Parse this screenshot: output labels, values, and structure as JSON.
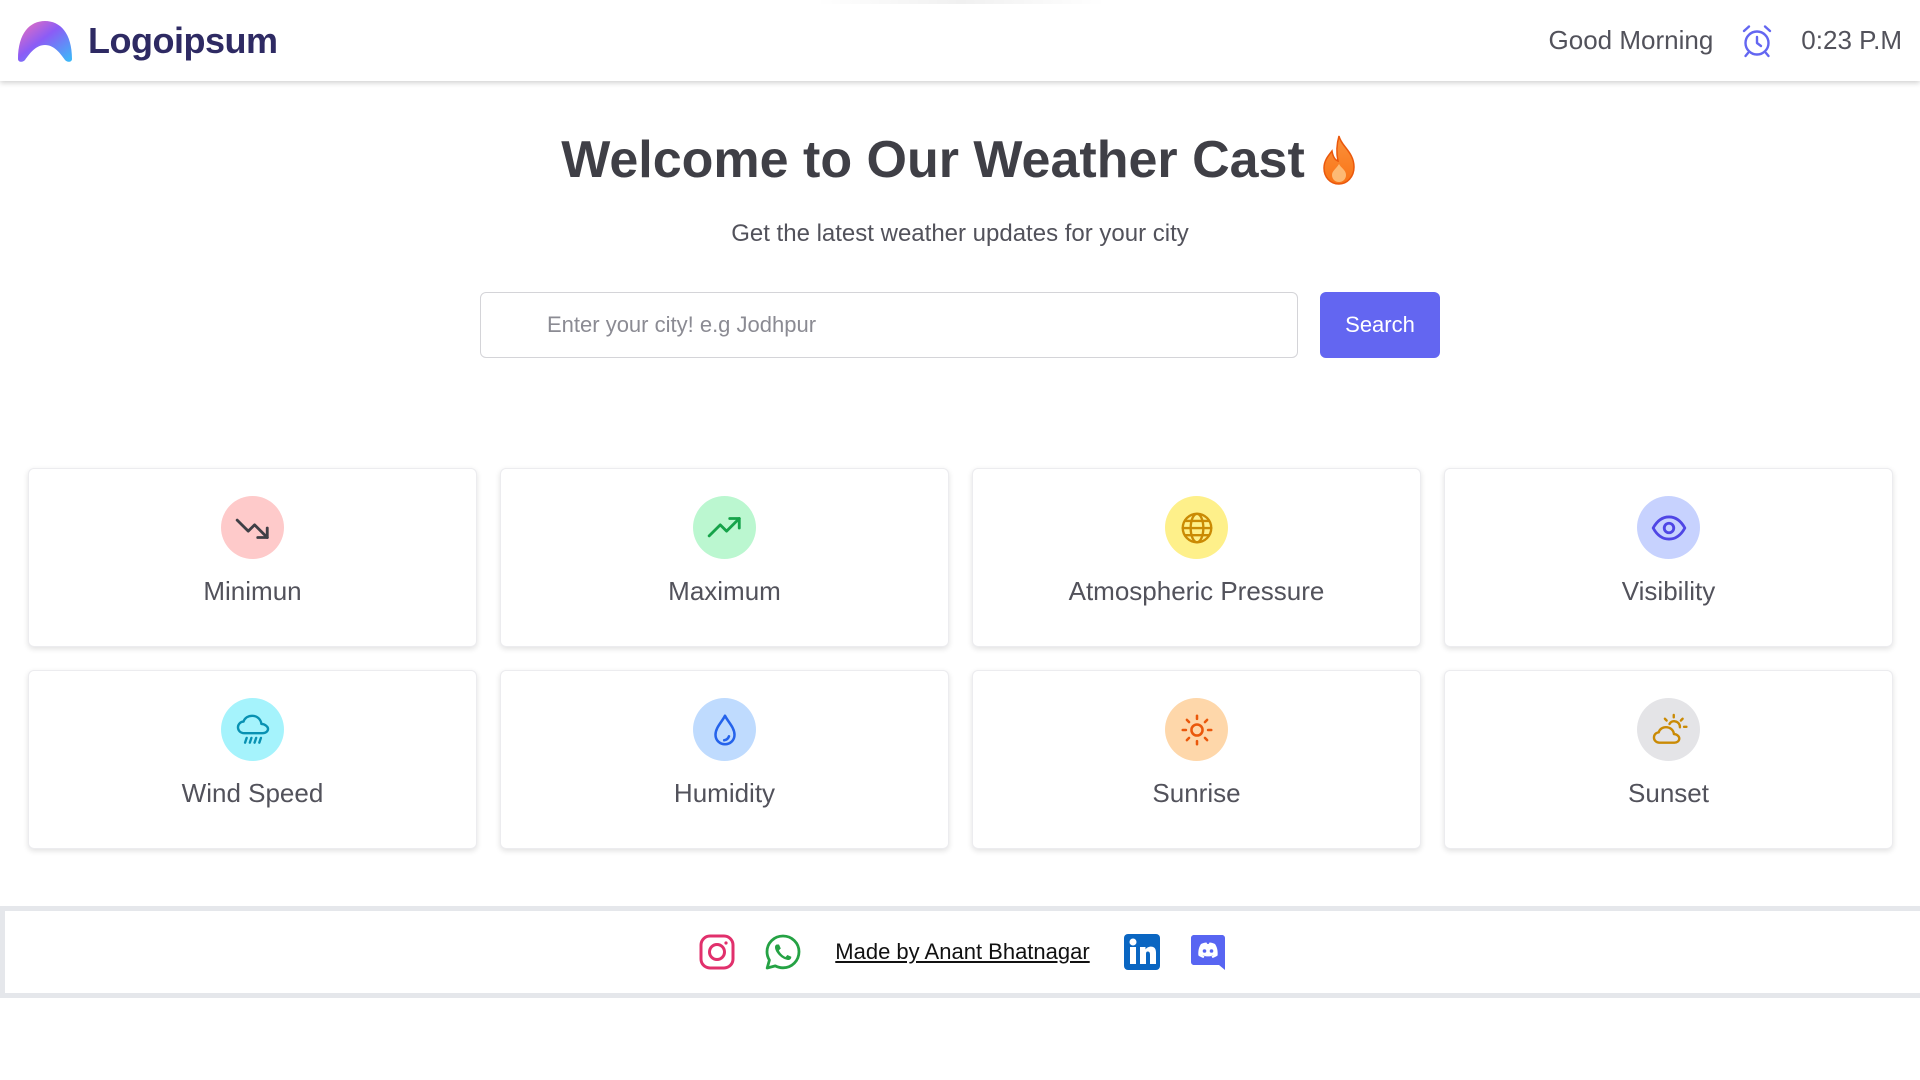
{
  "header": {
    "brand": "Logoipsum",
    "greeting": "Good Morning",
    "clock": "0:23 P.M",
    "icons": [
      "logoipsum-logo",
      "alarm-clock-icon"
    ]
  },
  "hero": {
    "title": "Welcome to Our Weather Cast",
    "title_icon": "fire-icon",
    "subtitle": "Get the latest weather updates for your city"
  },
  "search": {
    "placeholder": "Enter your city! e.g Jodhpur",
    "value": "",
    "button_label": "Search"
  },
  "cards": [
    {
      "label": "Minimun",
      "icon": "trending-down-icon",
      "icon_bg": "#fecaca",
      "icon_color": "#3f3f46"
    },
    {
      "label": "Maximum",
      "icon": "trending-up-icon",
      "icon_bg": "#bbf7d0",
      "icon_color": "#16a34a"
    },
    {
      "label": "Atmospheric Pressure",
      "icon": "globe-icon",
      "icon_bg": "#fef08a",
      "icon_color": "#ca8a04"
    },
    {
      "label": "Visibility",
      "icon": "eye-icon",
      "icon_bg": "#c7d2fe",
      "icon_color": "#4f46e5"
    },
    {
      "label": "Wind Speed",
      "icon": "cloud-rain-icon",
      "icon_bg": "#a5f3fc",
      "icon_color": "#0891b2"
    },
    {
      "label": "Humidity",
      "icon": "droplet-icon",
      "icon_bg": "#bfdbfe",
      "icon_color": "#2563eb"
    },
    {
      "label": "Sunrise",
      "icon": "sun-icon",
      "icon_bg": "#fed7aa",
      "icon_color": "#ea580c"
    },
    {
      "label": "Sunset",
      "icon": "cloud-sun-icon",
      "icon_bg": "#e4e4e7",
      "icon_color": "#ca8a04"
    }
  ],
  "footer": {
    "credit": "Made by Anant Bhatnagar",
    "icons": [
      "instagram-icon",
      "whatsapp-icon",
      "linkedin-icon",
      "discord-icon"
    ]
  },
  "colors": {
    "accent": "#6366f1",
    "brand_text": "#2e2a63",
    "instagram": "#e1306c",
    "whatsapp": "#25a244",
    "linkedin": "#0a66c2",
    "discord": "#5865f2"
  }
}
